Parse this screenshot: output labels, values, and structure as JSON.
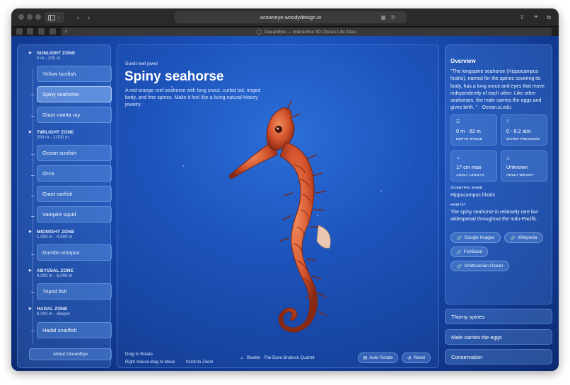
{
  "browser": {
    "url": "oceaneye.woodydesign.io",
    "tab_title": "OceanEye — Interactive 3D Ocean Life Atlas"
  },
  "sidebar": {
    "zones": [
      {
        "name": "SUNLIGHT ZONE",
        "depth": "0 m - 200 m",
        "creatures": [
          "Yellow boxfish",
          "Spiny seahorse",
          "Giant manta ray"
        ]
      },
      {
        "name": "TWILIGHT ZONE",
        "depth": "200 m - 1,000 m",
        "creatures": [
          "Ocean sunfish",
          "Orca",
          "Giant oarfish",
          "Vampire squid"
        ]
      },
      {
        "name": "MIDNIGHT ZONE",
        "depth": "1,000 m - 4,000 m",
        "creatures": [
          "Dumbo octopus"
        ]
      },
      {
        "name": "ABYSSAL ZONE",
        "depth": "4,000 m - 6,000 m",
        "creatures": [
          "Tripod fish"
        ]
      },
      {
        "name": "HADAL ZONE",
        "depth": "6,000 m - deeper",
        "creatures": [
          "Hadal snailfish"
        ]
      }
    ],
    "selected": "Spiny seahorse",
    "about_label": "About OceanEye"
  },
  "viewer": {
    "eyebrow": "Sunlit reef jewel",
    "title": "Spiny seahorse",
    "description": "A red-orange reef seahorse with long snout, curled tail, ringed body, and fine spines. Make it feel like a living natural-history jewelry.",
    "hint_rotate": "Drag to Rotate",
    "hint_move": "Right mouse drag to Move",
    "hint_sep": "·",
    "hint_zoom": "Scroll to Zoom",
    "music": "Bluette · The Dave Brubeck Quartet",
    "auto_rotate_label": "Auto Rotate",
    "reset_label": "Reset"
  },
  "overview": {
    "title": "Overview",
    "quote": "\"The longspine seahorse (Hippocampus histrix), named for the spines covering its body, has a long snout and eyes that move independently of each other. Like other seahorses, the male carries the eggs and gives birth. \" - Ocean.si.edu",
    "stats": [
      {
        "icon": "depth-icon",
        "value": "0 m - 82 m",
        "label": "DEPTH RANGE"
      },
      {
        "icon": "pressure-icon",
        "value": "0 - 8.2 atm",
        "label": "WATER PRESSURE"
      },
      {
        "icon": "length-icon",
        "value": "17 cm max",
        "label": "ADULT LENGTH"
      },
      {
        "icon": "weight-icon",
        "value": "Unknown",
        "label": "ADULT WEIGHT"
      }
    ],
    "scientific_name_label": "SCIENTIFIC NAME",
    "scientific_name": "Hippocampus histrix",
    "habitat_label": "HABITAT",
    "habitat": "The spiny seahorse is relatively rare but widespread throughout the Indo-Pacific.",
    "links": [
      "Google Images",
      "Wikipedia",
      "FishBase",
      "Smithsonian Ocean"
    ]
  },
  "accordions": [
    "Thorny spines",
    "Male carries the eggs",
    "Conservation"
  ]
}
